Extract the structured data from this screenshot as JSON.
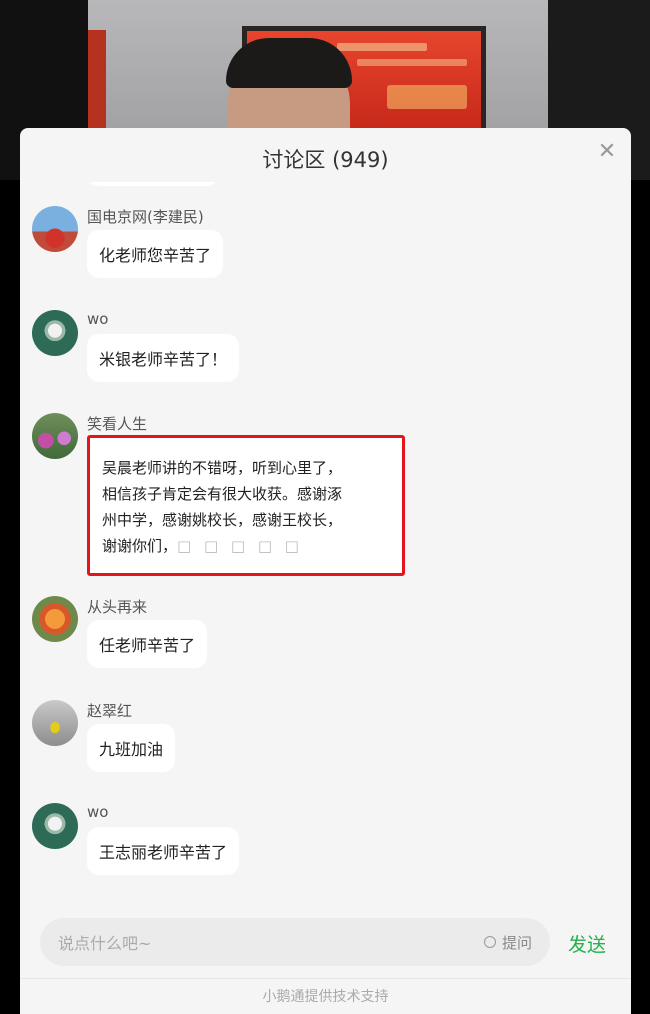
{
  "panel": {
    "title": "讨论区 (949)",
    "close_icon": "close-icon"
  },
  "messages": [
    {
      "name": "国电京网(李建民)",
      "text": "化老师您辛苦了",
      "avatar": "flag-avatar"
    },
    {
      "name": "wo",
      "text": "米银老师辛苦了！",
      "avatar": "flower-avatar"
    },
    {
      "name": "笑看人生",
      "lines": [
        "吴晨老师讲的不错呀，听到心里了，",
        "相信孩子肯定会有很大收获。感谢涿",
        "州中学，感谢姚校长，感谢王校长，",
        "谢谢你们，"
      ],
      "tofu": "□ □ □ □ □",
      "avatar": "field-avatar",
      "highlight_color": "#e3151a"
    },
    {
      "name": "从头再来",
      "text": "任老师辛苦了",
      "avatar": "orange-flower-avatar"
    },
    {
      "name": "赵翠红",
      "text": "九班加油",
      "avatar": "person-avatar"
    },
    {
      "name": "wo",
      "text": "王志丽老师辛苦了",
      "avatar": "flower-avatar"
    }
  ],
  "input": {
    "placeholder": "说点什么吧~",
    "ask_label": "提问",
    "send_label": "发送"
  },
  "footer": "小鹅通提供技术支持",
  "colors": {
    "send": "#23b14d",
    "highlight": "#e3151a"
  }
}
